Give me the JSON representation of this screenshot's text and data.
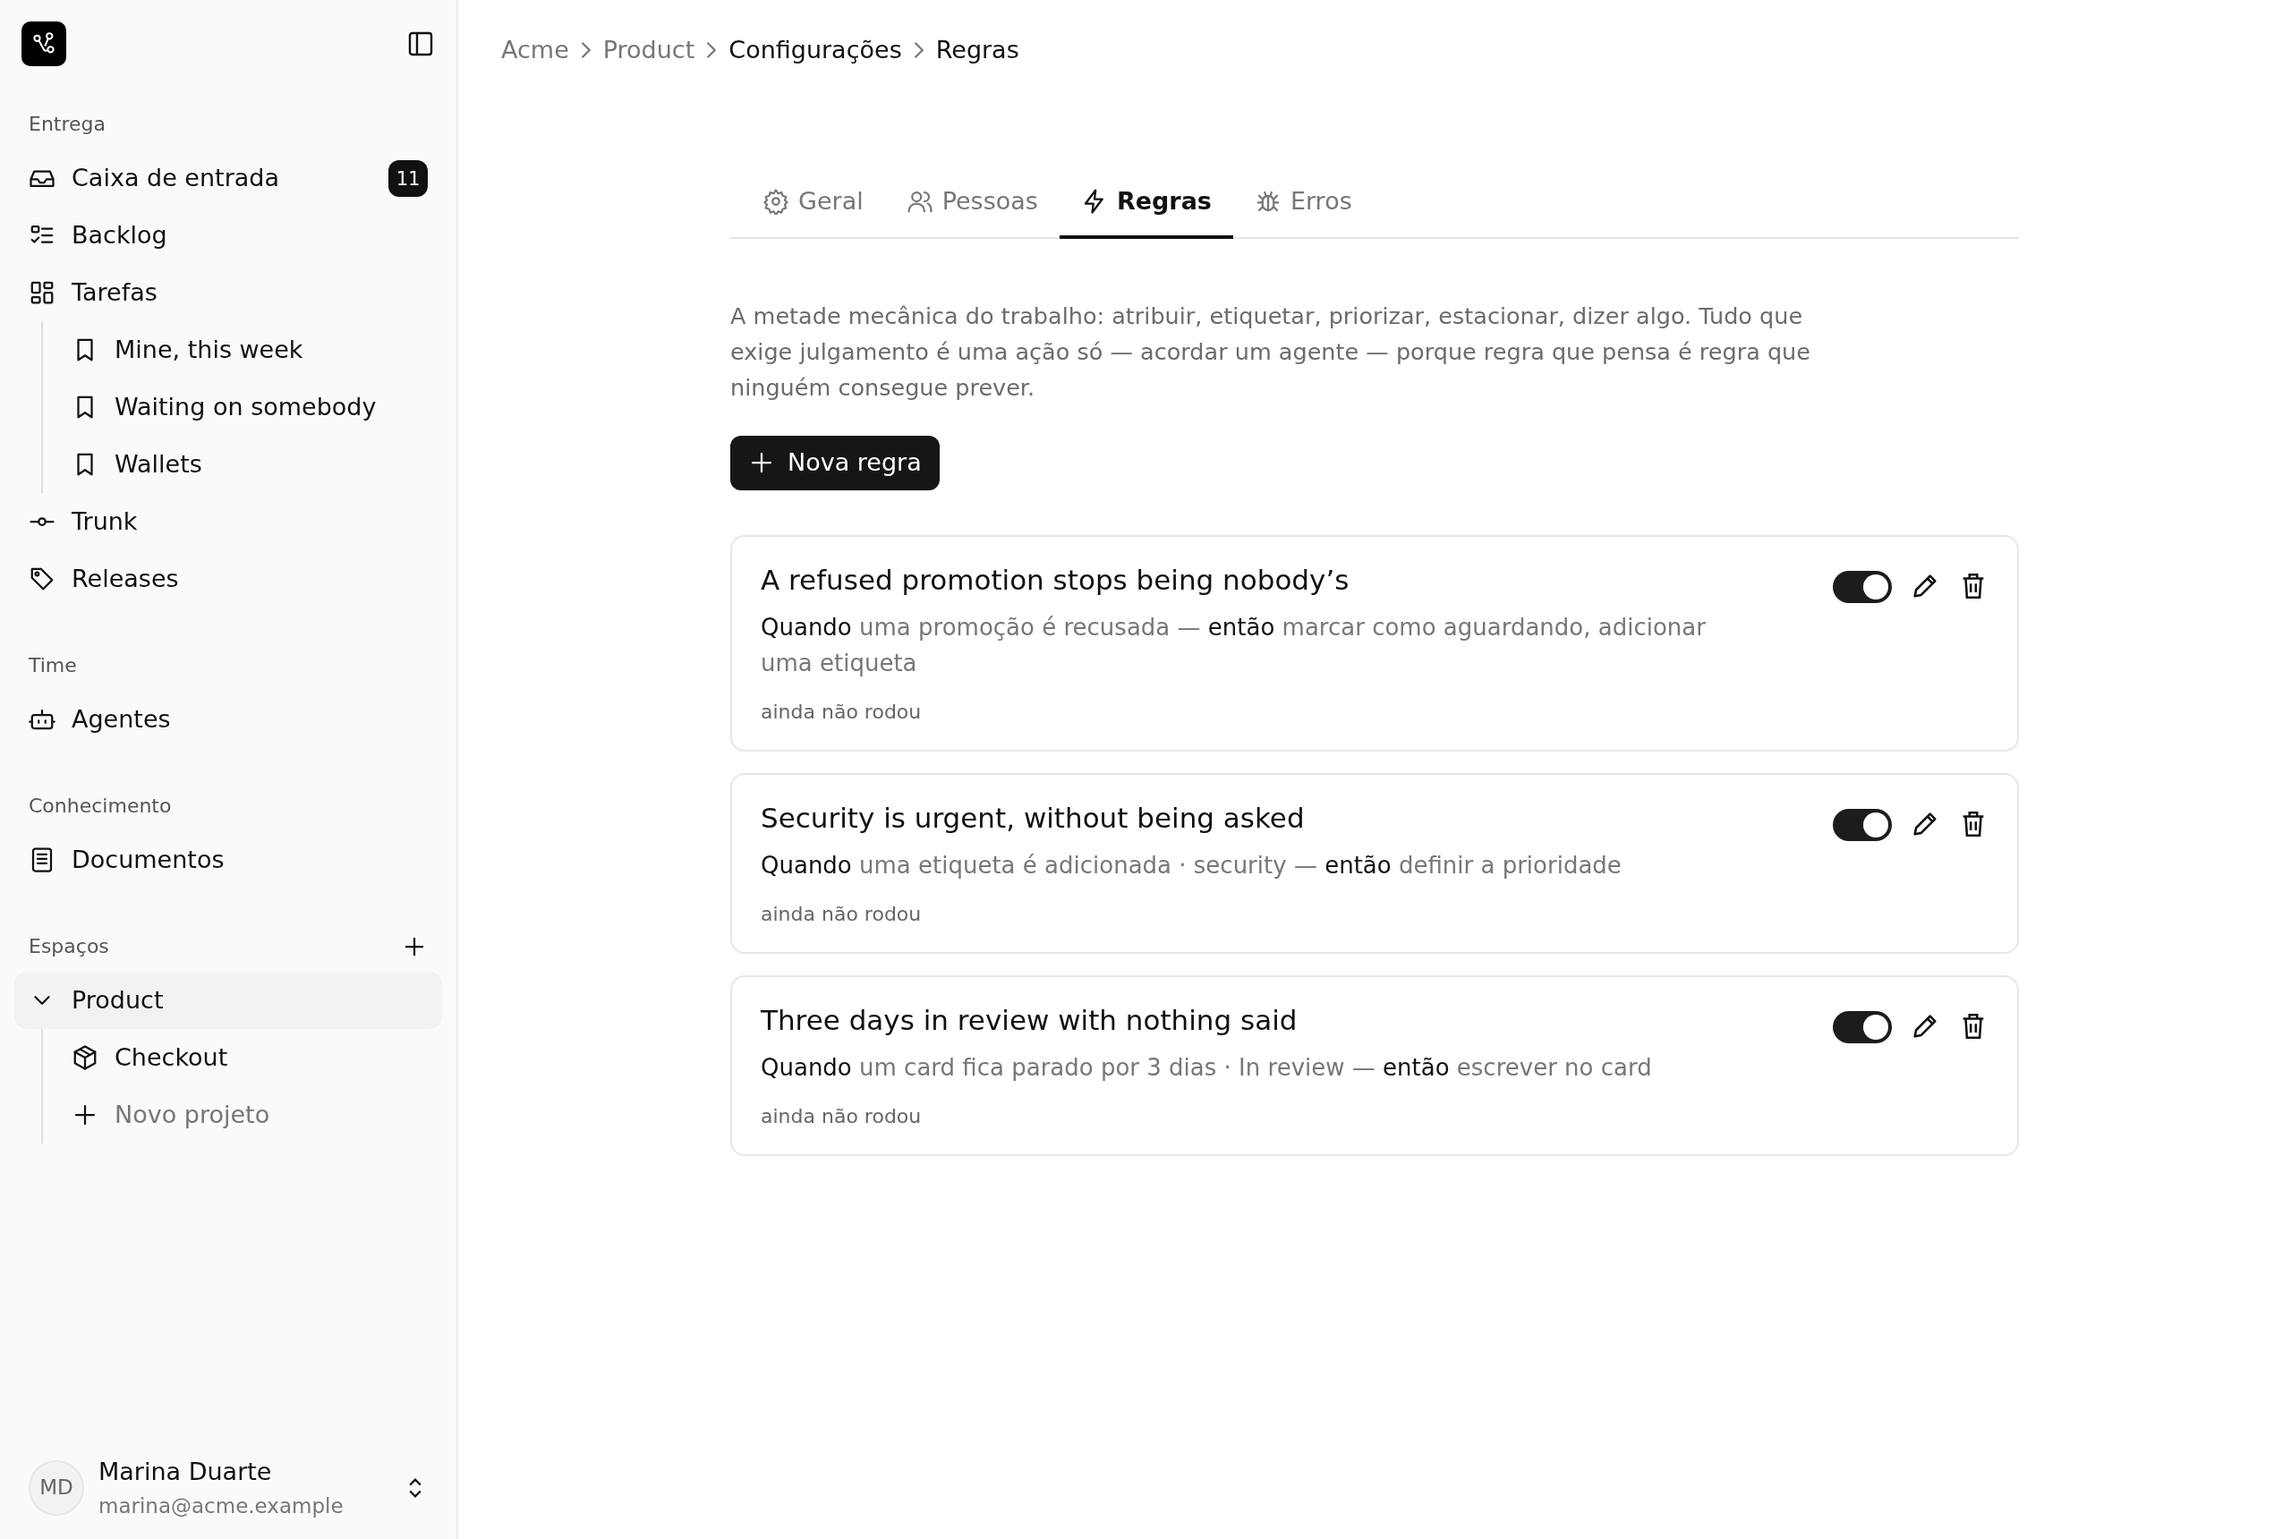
{
  "sidebar": {
    "sections": [
      {
        "title": "Entrega",
        "items": [
          {
            "label": "Caixa de entrada",
            "kind": "inbox",
            "badge": "11"
          },
          {
            "label": "Backlog",
            "kind": "checklist"
          },
          {
            "label": "Tarefas",
            "kind": "grid",
            "children": [
              {
                "label": "Mine, this week",
                "kind": "bookmark"
              },
              {
                "label": "Waiting on somebody",
                "kind": "bookmark"
              },
              {
                "label": "Wallets",
                "kind": "bookmark"
              }
            ]
          },
          {
            "label": "Trunk",
            "kind": "commit"
          },
          {
            "label": "Releases",
            "kind": "tag"
          }
        ]
      },
      {
        "title": "Time",
        "items": [
          {
            "label": "Agentes",
            "kind": "bot"
          }
        ]
      },
      {
        "title": "Conhecimento",
        "items": [
          {
            "label": "Documentos",
            "kind": "document"
          }
        ]
      },
      {
        "title": "Espaços",
        "add": true,
        "items": [
          {
            "label": "Product",
            "kind": "chevron",
            "expanded": true,
            "children": [
              {
                "label": "Checkout",
                "kind": "box"
              },
              {
                "label": "Novo projeto",
                "kind": "plus",
                "muted": true
              }
            ]
          }
        ]
      }
    ],
    "user": {
      "initials": "MD",
      "name": "Marina Duarte",
      "email": "marina@acme.example"
    }
  },
  "breadcrumbs": [
    {
      "label": "Acme",
      "current": false
    },
    {
      "label": "Product",
      "current": false
    },
    {
      "label": "Configurações",
      "current": true
    },
    {
      "label": "Regras",
      "current": true
    }
  ],
  "tabs": [
    {
      "label": "Geral",
      "kind": "gear",
      "selected": false
    },
    {
      "label": "Pessoas",
      "kind": "people",
      "selected": false
    },
    {
      "label": "Regras",
      "kind": "bolt",
      "selected": true
    },
    {
      "label": "Erros",
      "kind": "bug",
      "selected": false
    }
  ],
  "description": "A metade mecânica do trabalho: atribuir, etiquetar, priorizar, estacionar, dizer algo. Tudo que exige julgamento é uma ação só — acordar um agente — porque regra que pensa é regra que ninguém consegue prever.",
  "new_button": "Nova regra",
  "rules": [
    {
      "title": "A refused promotion stops being nobody’s",
      "when": "Quando",
      "trigger": "uma promoção é recusada —",
      "then": "então",
      "action": "marcar como aguardando, adicionar uma etiqueta",
      "status": "ainda não rodou",
      "enabled": true
    },
    {
      "title": "Security is urgent, without being asked",
      "when": "Quando",
      "trigger": "uma etiqueta é adicionada · security —",
      "then": "então",
      "action": "definir a prioridade",
      "status": "ainda não rodou",
      "enabled": true
    },
    {
      "title": "Three days in review with nothing said",
      "when": "Quando",
      "trigger": "um card fica parado por 3 dias · In review —",
      "then": "então",
      "action": "escrever no card",
      "status": "ainda não rodou",
      "enabled": true
    }
  ]
}
